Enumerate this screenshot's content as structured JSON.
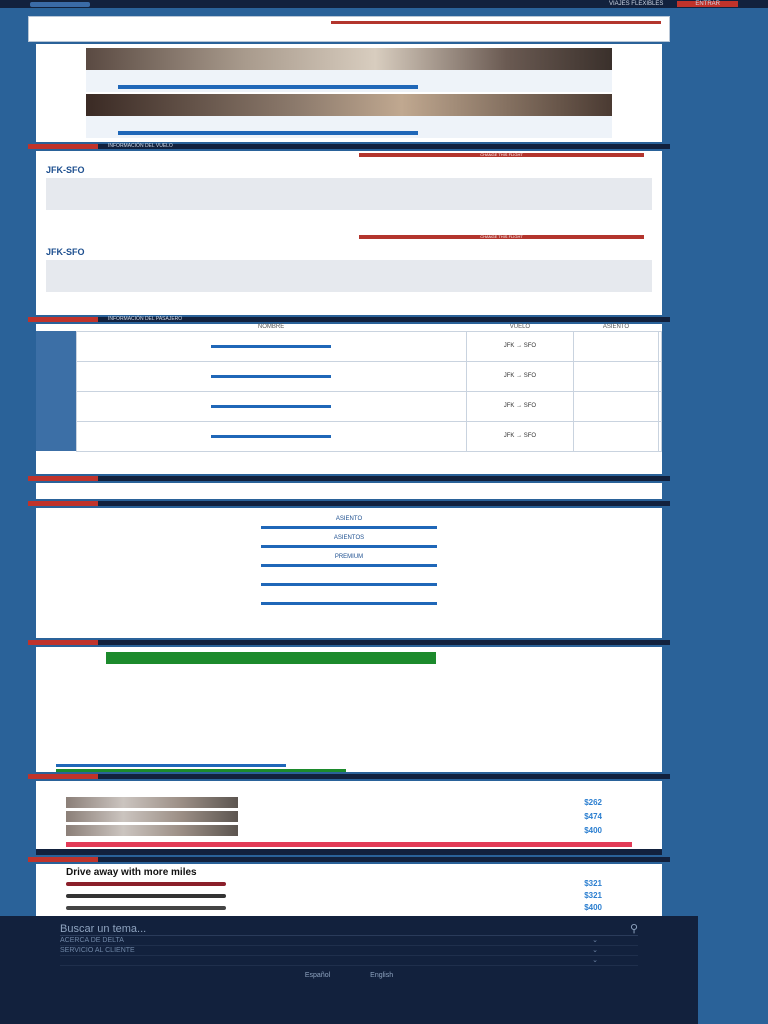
{
  "topbar": {
    "menu": [
      "VIAJES FLEXIBLES"
    ],
    "enter_label": "ENTRAR"
  },
  "flight_section_title": "INFORMACIÓN DEL VUELO",
  "change_flight_label": "CHANGE THIS FLIGHT",
  "passenger_section_title": "INFORMACIÓN DEL PASAJERO",
  "flights": [
    {
      "code": "JFK-SFO"
    },
    {
      "code": "JFK-SFO"
    }
  ],
  "passengers": {
    "headers": [
      "NOMBRE",
      "VUELO",
      "ASIENTO"
    ],
    "rows": [
      {
        "route": "JFK → SFO"
      },
      {
        "route": "JFK → SFO"
      },
      {
        "route": "JFK → SFO"
      },
      {
        "route": "JFK → SFO"
      }
    ]
  },
  "seat_options": [
    "ASIENTO",
    "ASIENTOS",
    "PREMIUM"
  ],
  "hotels": [
    {
      "price": "$262"
    },
    {
      "price": "$474"
    },
    {
      "price": "$400"
    }
  ],
  "car": {
    "title": "Drive away with more miles",
    "items": [
      {
        "price": "$321"
      },
      {
        "price": "$321"
      },
      {
        "price": "$400"
      }
    ]
  },
  "footer": {
    "search_placeholder": "Buscar un tema...",
    "links": [
      "ACERCA DE DELTA",
      "SERVICIO AL CLIENTE"
    ],
    "languages": [
      "Español",
      "English"
    ]
  },
  "colors": {
    "brand": "#12213d",
    "accent": "#c0332b",
    "link": "#1f67b8"
  }
}
